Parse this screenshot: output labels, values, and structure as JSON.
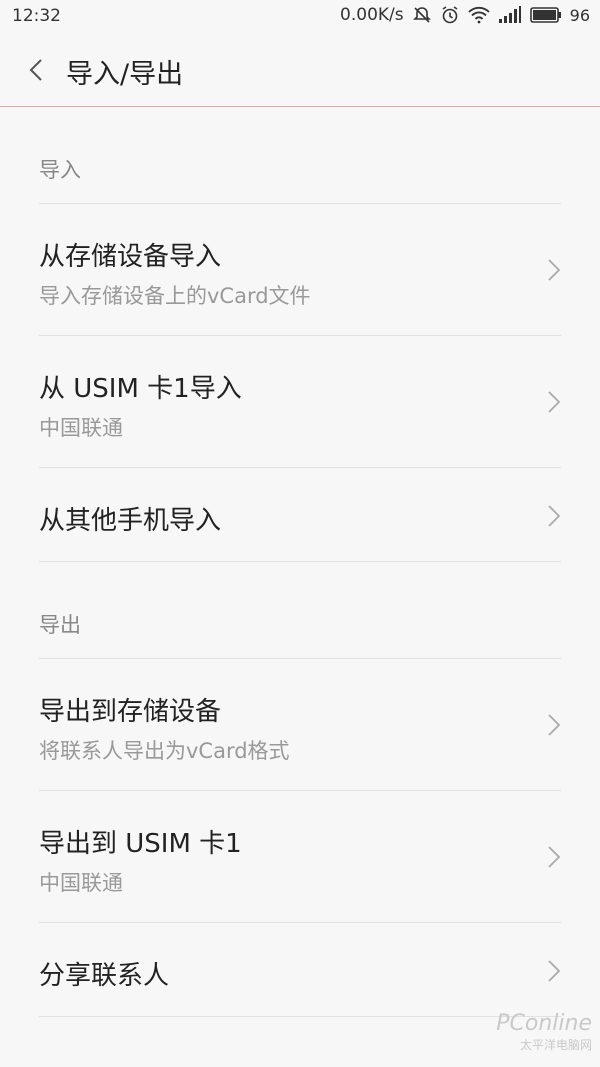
{
  "status_bar": {
    "time": "12:32",
    "network_speed": "0.00K/s",
    "battery": "96",
    "icons": [
      "muted-notification-icon",
      "alarm-icon",
      "wifi-icon",
      "signal-icon",
      "battery-icon"
    ]
  },
  "header": {
    "title": "导入/导出",
    "back_icon": "chevron-left-icon"
  },
  "sections": [
    {
      "label": "导入",
      "items": [
        {
          "title": "从存储设备导入",
          "subtitle": "导入存储设备上的vCard文件"
        },
        {
          "title": "从 USIM 卡1导入",
          "subtitle": "中国联通"
        },
        {
          "title": "从其他手机导入",
          "subtitle": ""
        }
      ]
    },
    {
      "label": "导出",
      "items": [
        {
          "title": "导出到存储设备",
          "subtitle": "将联系人导出为vCard格式"
        },
        {
          "title": "导出到 USIM 卡1",
          "subtitle": "中国联通"
        },
        {
          "title": "分享联系人",
          "subtitle": ""
        }
      ]
    }
  ],
  "watermark": {
    "brand": "PConline",
    "sub": "太平洋电脑网"
  },
  "colors": {
    "background": "#f7f7f7",
    "header_divider": "#e6a7a0",
    "text_primary": "#222222",
    "text_secondary": "#999999",
    "divider": "#e1e1e1"
  }
}
